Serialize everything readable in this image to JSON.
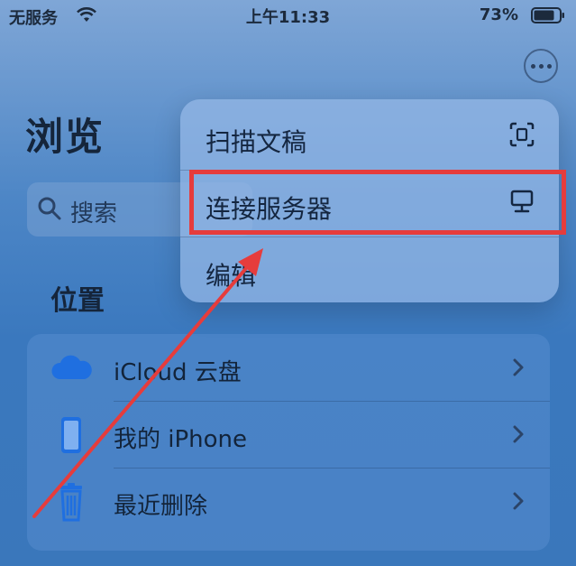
{
  "status_bar": {
    "carrier": "无服务",
    "time": "上午11:33",
    "battery": "73%"
  },
  "page": {
    "title": "浏览",
    "search_label": "搜索",
    "section_title": "位置"
  },
  "menu": {
    "items": [
      {
        "label": "扫描文稿",
        "icon": "scan-document-icon"
      },
      {
        "label": "连接服务器",
        "icon": "server-display-icon"
      },
      {
        "label": "编辑",
        "icon": ""
      }
    ]
  },
  "locations": [
    {
      "label": "iCloud 云盘",
      "icon": "cloud-icon"
    },
    {
      "label": "我的 iPhone",
      "icon": "iphone-icon"
    },
    {
      "label": "最近删除",
      "icon": "trash-icon"
    }
  ],
  "colors": {
    "highlight": "#e63c3c",
    "icon_blue": "#1f6fe0"
  }
}
